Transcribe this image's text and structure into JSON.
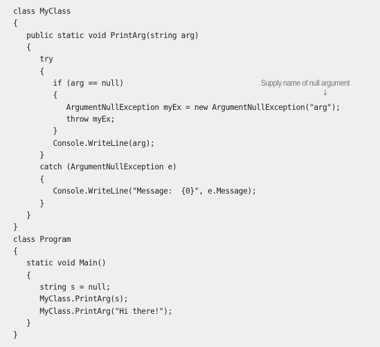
{
  "code": {
    "language": "C#",
    "lines": [
      "class MyClass",
      "{",
      "   public static void PrintArg(string arg)",
      "   {",
      "      try",
      "      {",
      "         if (arg == null)",
      "         {",
      "            ArgumentNullException myEx = new ArgumentNullException(\"arg\");",
      "            throw myEx;",
      "         }",
      "         Console.WriteLine(arg);",
      "      }",
      "      catch (ArgumentNullException e)",
      "      {",
      "         Console.WriteLine(\"Message:  {0}\", e.Message);",
      "      }",
      "   }",
      "}",
      "class Program",
      "{",
      "   static void Main()",
      "   {",
      "      string s = null;",
      "      MyClass.PrintArg(s);",
      "      MyClass.PrintArg(\"Hi there!\");",
      "   }",
      "}"
    ]
  },
  "annotation": {
    "text": "Supply name of null argument",
    "arrow_icon": "down-arrow",
    "arrow_glyph": "↓"
  }
}
